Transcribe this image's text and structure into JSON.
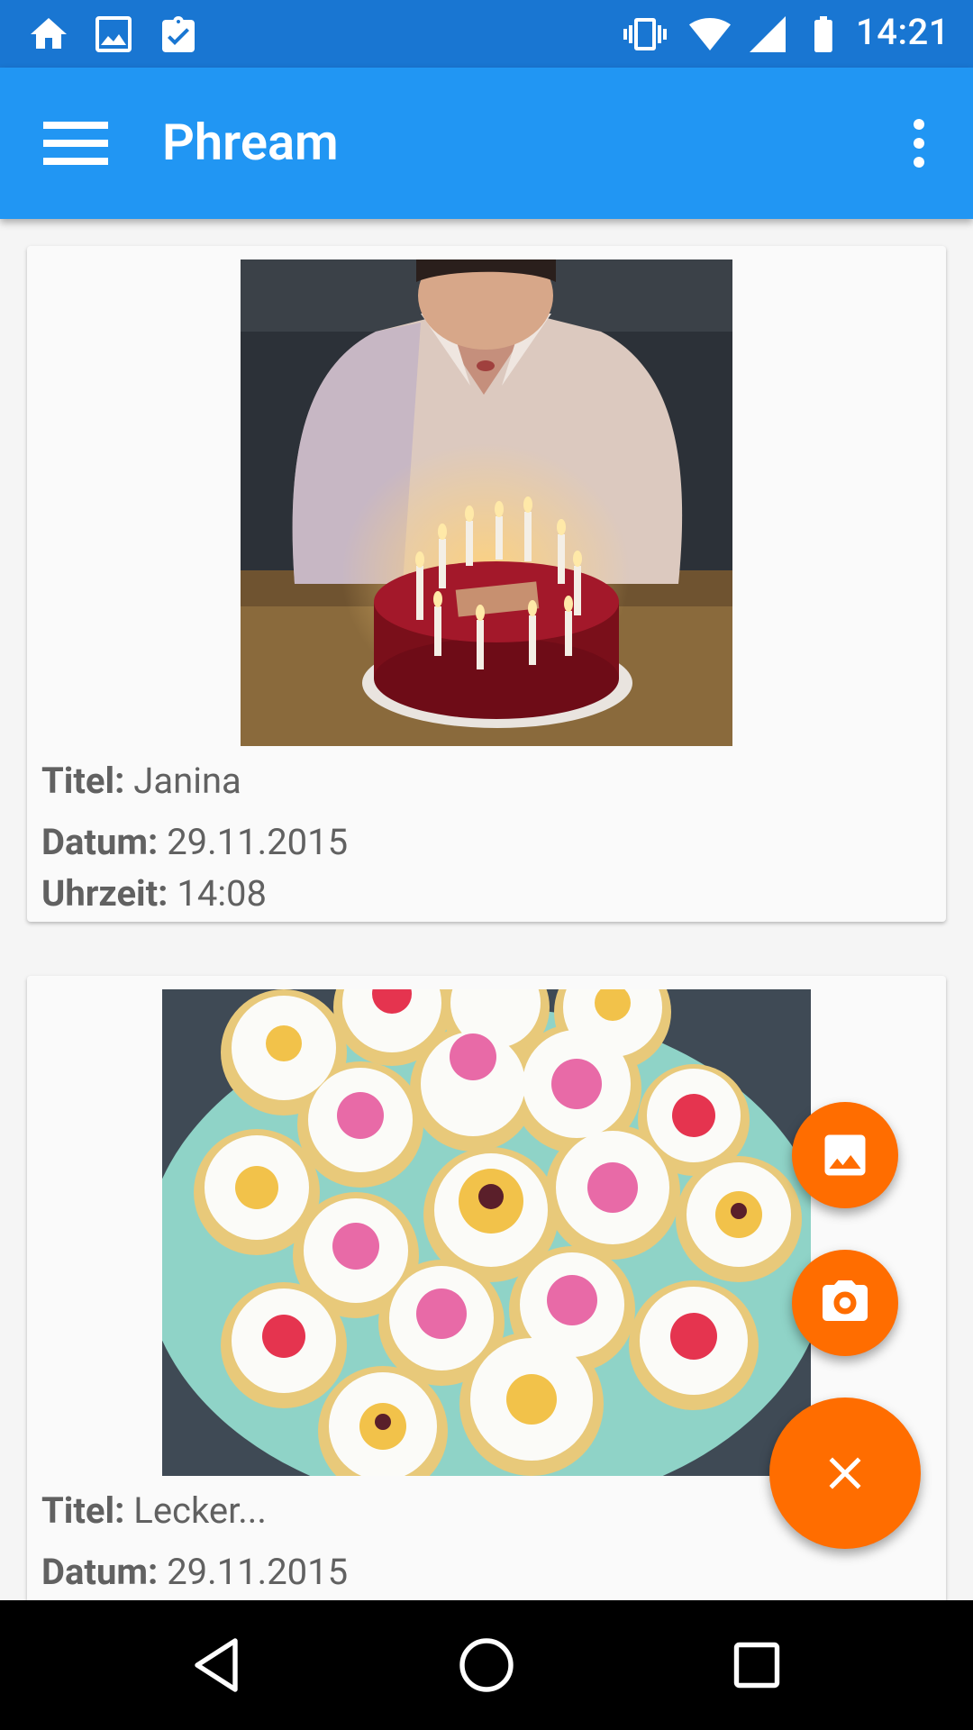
{
  "status_bar": {
    "time": "14:21",
    "left_icons": [
      "home-icon",
      "image-icon",
      "clipboard-check-icon"
    ],
    "right_icons": [
      "vibrate-icon",
      "wifi-icon",
      "signal-icon",
      "battery-icon"
    ]
  },
  "toolbar": {
    "title": "Phream",
    "menu_icon": "hamburger-menu-icon",
    "overflow_icon": "more-vert-icon",
    "color": "#2196F3"
  },
  "cards": [
    {
      "image": "birthday-cake-photo",
      "title_label": "Titel:",
      "title_value": "Janina",
      "date_label": "Datum:",
      "date_value": "29.11.2015",
      "time_label": "Uhrzeit:",
      "time_value": "14:08"
    },
    {
      "image": "cupcakes-photo",
      "title_label": "Titel:",
      "title_value": "Lecker...",
      "date_label": "Datum:",
      "date_value": "29.11.2015"
    }
  ],
  "fabs": {
    "gallery_icon": "image-icon",
    "camera_icon": "camera-icon",
    "close_icon": "close-icon",
    "color": "#FF6D00"
  },
  "nav_bar": {
    "back_icon": "back-icon",
    "home_icon": "home-circle-icon",
    "recents_icon": "recents-icon"
  }
}
